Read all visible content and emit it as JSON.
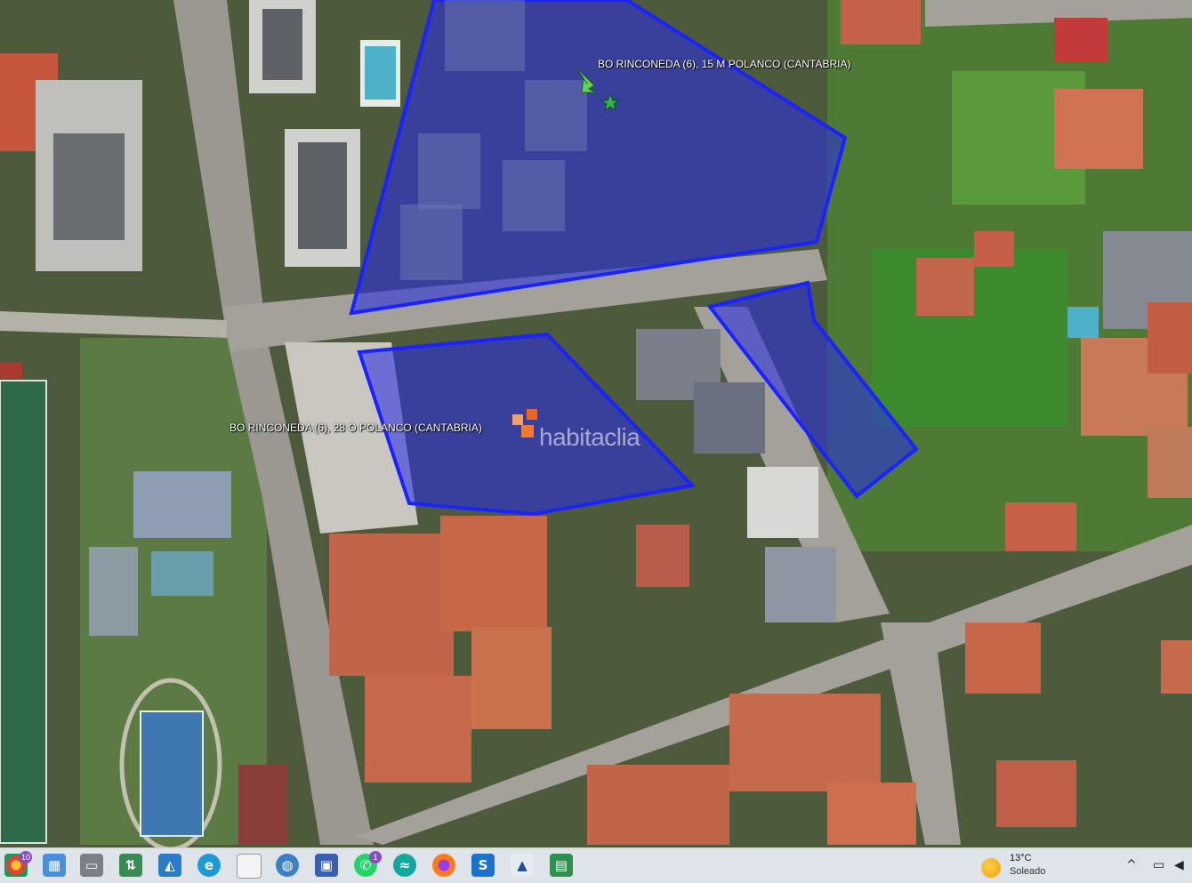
{
  "map": {
    "labels": {
      "north_plot": "BO RINCONEDA (6), 15 M POLANCO (CANTABRIA)",
      "south_plot": "BO RINCONEDA (6), 28 O POLANCO (CANTABRIA)"
    },
    "watermark": "habitaclia",
    "colors": {
      "plot_fill": "#2a2ee0",
      "plot_stroke": "#1a22ff",
      "marker_arrow": "#5fd35a",
      "marker_star": "#2fb84a",
      "logo_orange": "#f0641e"
    },
    "icons": {
      "marker": "green-arrow-star-icon",
      "logo": "habitaclia-logo-icon"
    }
  },
  "taskbar": {
    "items": [
      {
        "name": "chrome-icon",
        "badge": "10"
      },
      {
        "name": "photos-icon"
      },
      {
        "name": "snipping-icon"
      },
      {
        "name": "network-drive-icon"
      },
      {
        "name": "gallery-icon"
      },
      {
        "name": "edge-icon"
      },
      {
        "name": "document-icon"
      },
      {
        "name": "globe-icon"
      },
      {
        "name": "save-disk-icon"
      },
      {
        "name": "whatsapp-icon",
        "badge": "1"
      },
      {
        "name": "app-wave-icon"
      },
      {
        "name": "firefox-icon"
      },
      {
        "name": "s-app-icon"
      },
      {
        "name": "arrow-app-icon"
      },
      {
        "name": "sheet-app-icon"
      }
    ],
    "weather": {
      "temp": "13°C",
      "condition": "Soleado"
    },
    "tray": {
      "chevron": "^"
    }
  }
}
